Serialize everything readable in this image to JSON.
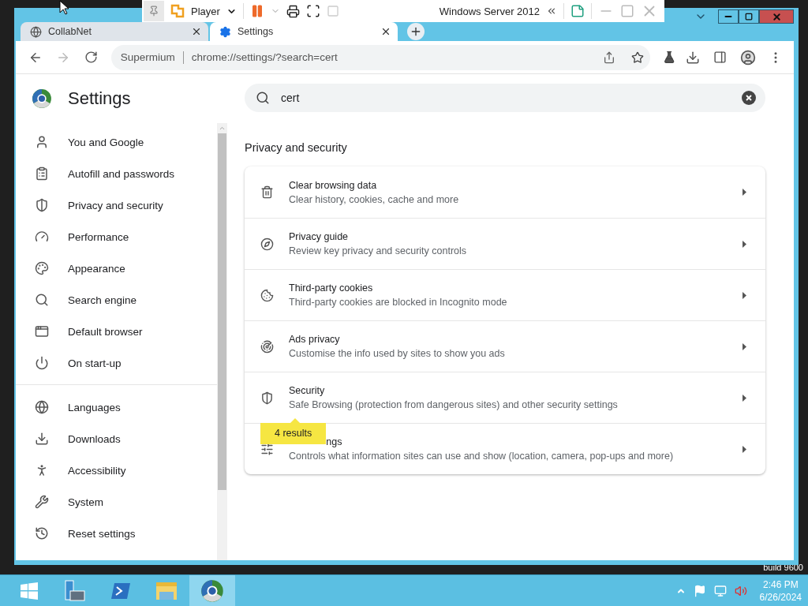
{
  "vm_toolbar": {
    "menu": "Player",
    "vm_name": "Windows Server 2012"
  },
  "browser": {
    "tabs": [
      {
        "title": "CollabNet",
        "selected": false
      },
      {
        "title": "Settings",
        "selected": true
      }
    ],
    "address": {
      "origin": "Supermium",
      "url": "chrome://settings/?search=cert"
    }
  },
  "settings": {
    "title": "Settings",
    "search": {
      "value": "cert"
    },
    "sidebar": {
      "groups": [
        [
          {
            "label": "You and Google",
            "selected": false
          },
          {
            "label": "Autofill and passwords",
            "selected": false
          },
          {
            "label": "Privacy and security",
            "selected": false
          },
          {
            "label": "Performance",
            "selected": false
          },
          {
            "label": "Appearance",
            "selected": false
          },
          {
            "label": "Search engine",
            "selected": false
          },
          {
            "label": "Default browser",
            "selected": false
          },
          {
            "label": "On start-up",
            "selected": false
          }
        ],
        [
          {
            "label": "Languages",
            "selected": false
          },
          {
            "label": "Downloads",
            "selected": false
          },
          {
            "label": "Accessibility",
            "selected": false
          },
          {
            "label": "System",
            "selected": false
          },
          {
            "label": "Reset settings",
            "selected": false
          }
        ]
      ]
    },
    "section": "Privacy and security",
    "rows": [
      {
        "title": "Clear browsing data",
        "subtitle": "Clear history, cookies, cache and more"
      },
      {
        "title": "Privacy guide",
        "subtitle": "Review key privacy and security controls"
      },
      {
        "title": "Third-party cookies",
        "subtitle": "Third-party cookies are blocked in Incognito mode"
      },
      {
        "title": "Ads privacy",
        "subtitle": "Customise the info used by sites to show you ads"
      },
      {
        "title": "Security",
        "subtitle": "Safe Browsing (protection from dangerous sites) and other security settings"
      },
      {
        "title": "ngs",
        "subtitle": "Controls what information sites can use and show (location, camera, pop-ups and more)",
        "tooltip": "4 results"
      }
    ]
  },
  "desktop": {
    "build_text": "build 9600"
  },
  "taskbar": {
    "time": "2:46 PM",
    "date": "6/26/2024"
  }
}
